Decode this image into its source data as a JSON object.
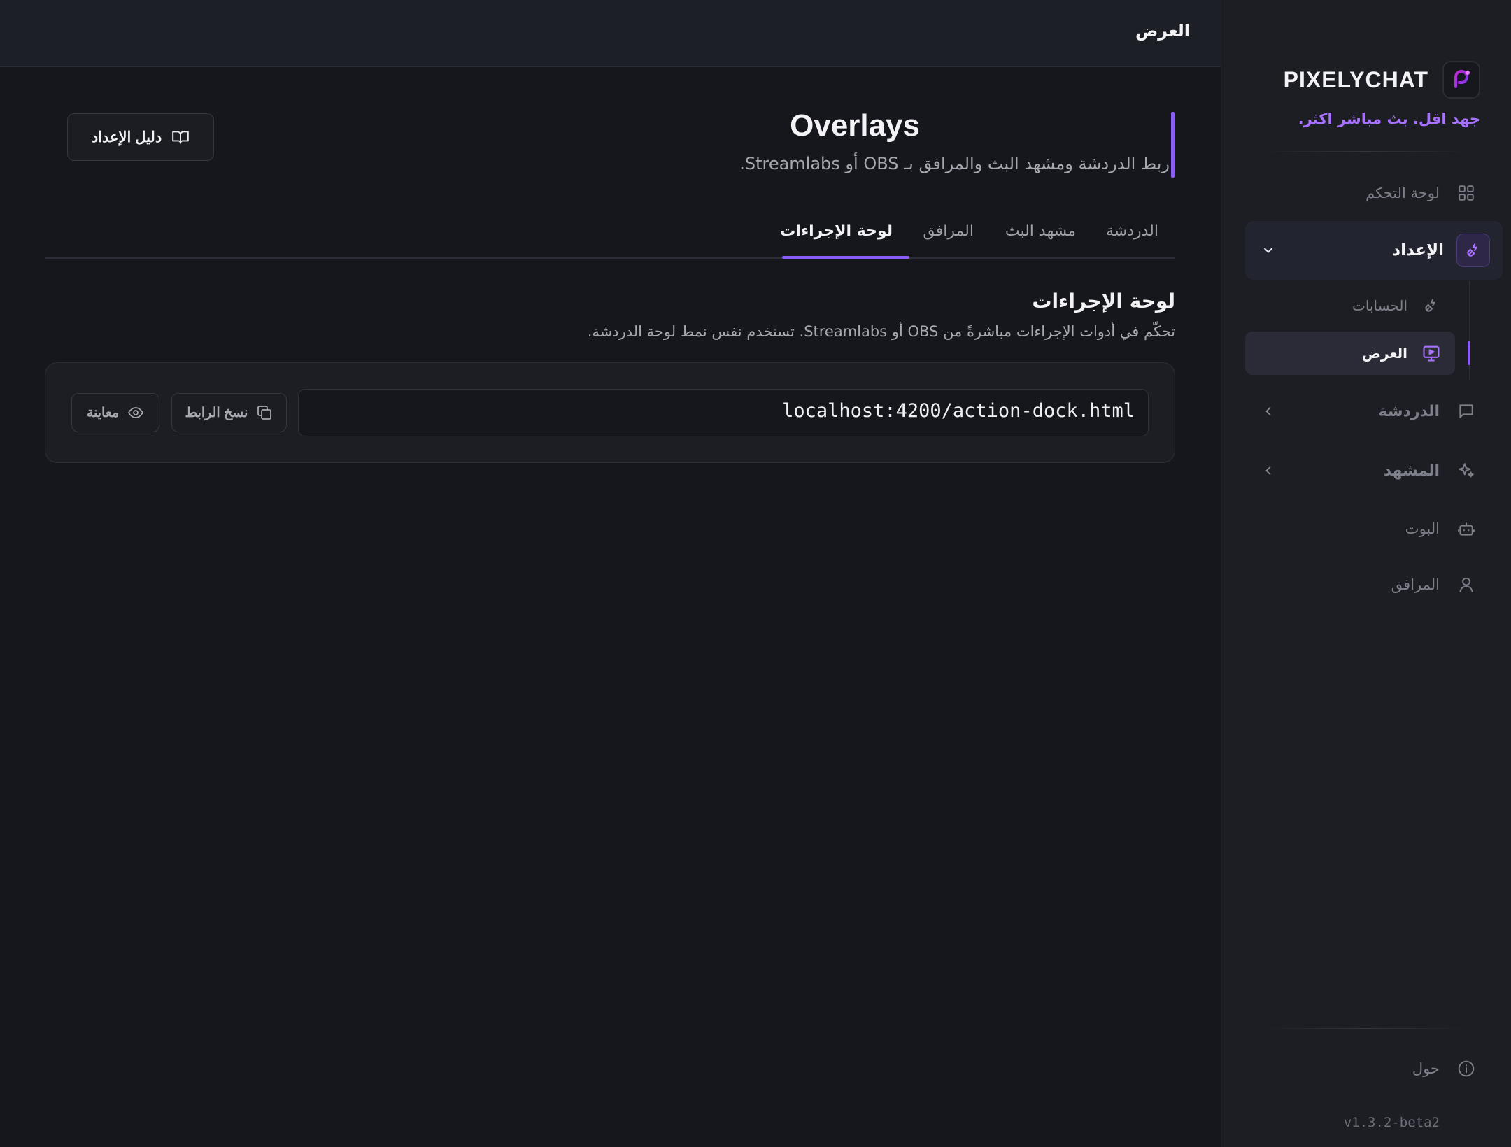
{
  "brand": {
    "name": "PIXELYCHAT",
    "tagline": "جهد اقل. بث مباشر اكثر."
  },
  "sidebar": {
    "dashboard": "لوحة التحكم",
    "setup": {
      "label": "الإعداد",
      "items": [
        "الحسابات",
        "العرض"
      ]
    },
    "chat": "الدردشة",
    "scene": "المشهد",
    "bot": "البوت",
    "companion": "المرافق",
    "about": "حول",
    "version": "v1.3.2-beta2"
  },
  "topbar": {
    "title": "العرض"
  },
  "page": {
    "title": "Overlays",
    "subtitle": "ربط الدردشة ومشهد البث والمرافق بـ OBS أو Streamlabs.",
    "guide_button": "دليل الإعداد"
  },
  "tabs": [
    "الدردشة",
    "مشهد البث",
    "المرافق",
    "لوحة الإجراءات"
  ],
  "active_tab": "لوحة الإجراءات",
  "section": {
    "title": "لوحة الإجراءات",
    "description": "تحكّم في أدوات الإجراءات مباشرةً من OBS أو Streamlabs. تستخدم نفس نمط لوحة الدردشة.",
    "url": "localhost:4200/action-dock.html",
    "copy_button": "نسخ الرابط",
    "preview_button": "معاينة"
  },
  "colors": {
    "accent": "#8b5cf6",
    "tagline": "#a872ff",
    "background": "#15171c",
    "sidebar": "#1c1e24"
  }
}
